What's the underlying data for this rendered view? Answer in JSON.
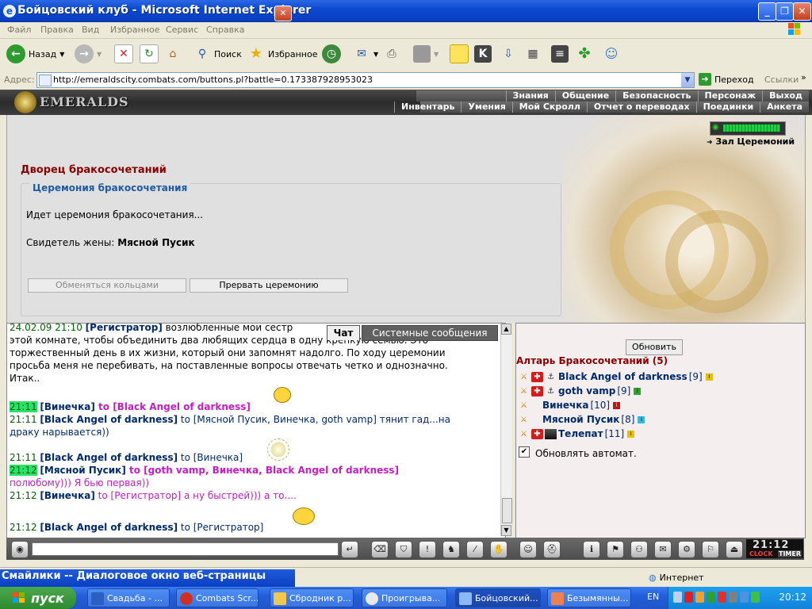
{
  "window": {
    "title": "Бойцовский клуб - Microsoft Internet Explorer"
  },
  "menu": [
    "Файл",
    "Правка",
    "Вид",
    "Избранное",
    "Сервис",
    "Справка"
  ],
  "toolbar": {
    "back": "Назад",
    "search": "Поиск",
    "favorites": "Избранное"
  },
  "address": {
    "label": "Адрес:",
    "url": "http://emeraldscity.combats.com/buttons.pl?battle=0.173387928953023",
    "go": "Переход",
    "links": "Ссылки"
  },
  "game": {
    "logo": "EMERALDS",
    "nav_top": [
      "Знания",
      "Общение",
      "Безопасность",
      "Персонаж",
      "Выход"
    ],
    "nav_bottom": [
      "Инвентарь",
      "Умения",
      "Мой Скролл",
      "Отчет о переводах",
      "Поединки",
      "Анкета"
    ],
    "hall_link": "Зал Церемоний",
    "page_title": "Дворец бракосочетаний",
    "ceremony_legend": "Церемония бракосочетания",
    "status": "Идет церемония бракосочетания...",
    "witness_label": "Свидетель жены:",
    "witness_name": "Мясной Пусик",
    "btn_rings": "Обменяться кольцами",
    "btn_stop": "Прервать церемонию"
  },
  "chat": {
    "tab_chat": "Чат",
    "tab_system": "Системные сообщения",
    "lines": [
      {
        "ts": "24.02.09 21:10",
        "name": "[Регистратор]",
        "text": " возлюбленные мои сестр"
      },
      {
        "text": "этой комнате, чтобы объединить два любящих сердца в одну крепкую семью. Это -"
      },
      {
        "text": "торжественный день в их жизни, который они запомнят надолго. По ходу церемонии"
      },
      {
        "text": "просьба меня не перебивать, на поставленные вопросы отвечать четко и однозначно."
      },
      {
        "text": "Итак.."
      },
      {
        "ts": "21:11",
        "name": "[Винечка]",
        "to": " to [Black Angel of darkness]"
      },
      {
        "ts": "21:11",
        "name": "[Black Angel of darkness]",
        "to": " to [Мясной Пусик, Винечка, goth vamp]",
        "text": " тянит гад...на"
      },
      {
        "text": "драку нарывается))"
      },
      {
        "ts": "21:11",
        "name": "[Black Angel of darkness]",
        "to": " to [Винечка]"
      },
      {
        "ts": "21:12",
        "name": "[Мясной Пусик]",
        "to": " to [goth vamp, Винечка, Black Angel of darkness]"
      },
      {
        "text": "полюбому))) Я бью первая))"
      },
      {
        "ts": "21:12",
        "name": "[Винечка]",
        "to": " to [Регистратор]",
        "text": " а ну быстрей))) а то...."
      },
      {
        "ts": "21:12",
        "name": "[Black Angel of darkness]",
        "to": " to [Регистратор]"
      }
    ]
  },
  "room": {
    "refresh": "Обновить",
    "title": "Алтарь Бракосочетаний (5)",
    "users": [
      {
        "name": "Black Angel of darkness",
        "level": "[9]"
      },
      {
        "name": "goth vamp",
        "level": "[9]"
      },
      {
        "name": "Винечка",
        "level": "[10]"
      },
      {
        "name": "Мясной Пусик",
        "level": "[8]"
      },
      {
        "name": "Телепат",
        "level": "[11]"
      }
    ],
    "auto_refresh": "Обновлять автомат."
  },
  "clock": {
    "time": "21:12",
    "clock_label": "CLOCK",
    "timer_label": "TIMER"
  },
  "statusbar": {
    "dialog": "Смайлики -- Диалоговое окно веб-страницы",
    "zone": "Интернет"
  },
  "taskbar": {
    "start": "пуск",
    "tasks": [
      "Свадьба - ...",
      "Combats Scr...",
      "Сбродник р...",
      "Проигрыва...",
      "Бойцовский...",
      "Безымянны..."
    ],
    "lang": "EN",
    "clock": "20:12"
  }
}
